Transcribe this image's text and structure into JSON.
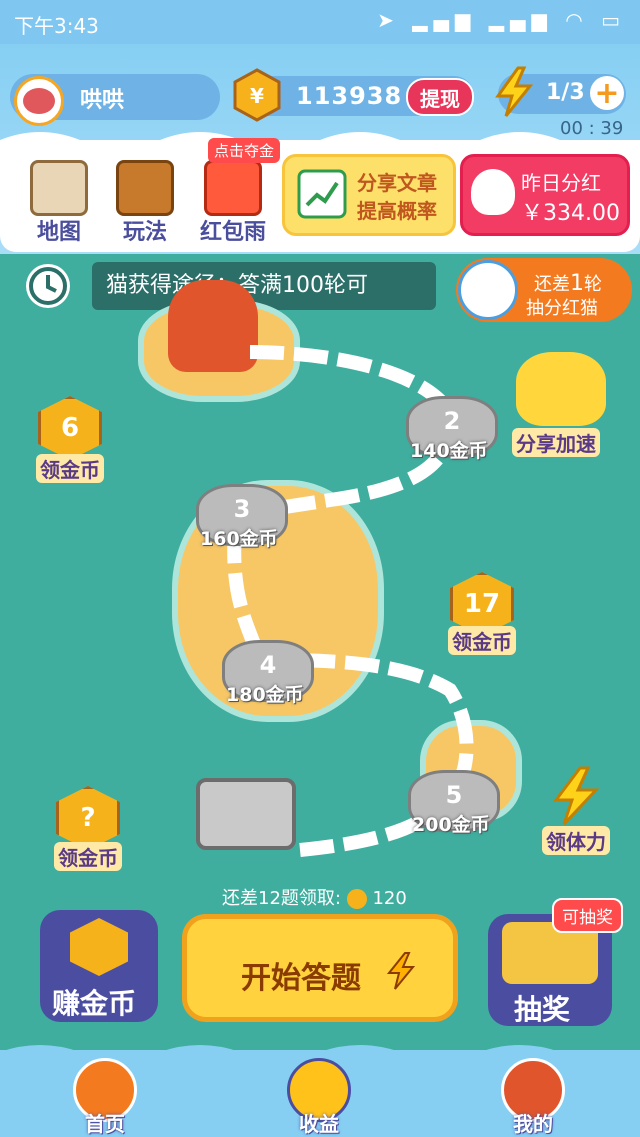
{
  "status_bar": {
    "time": "下午3:43"
  },
  "header": {
    "username": "哄哄",
    "coins": "113938",
    "withdraw_label": "提现",
    "energy": "1/3",
    "timer": "00 : 39"
  },
  "toolbar": {
    "items": [
      {
        "label": "地图",
        "icon": "map-icon"
      },
      {
        "label": "玩法",
        "icon": "rules-book-icon"
      },
      {
        "label": "红包雨",
        "icon": "red-envelope-rain-icon"
      }
    ],
    "grab_tag": "点击夺金",
    "share_line1": "分享文章",
    "share_line2": "提高概率",
    "bonus_line1": "昨日分红",
    "bonus_amount": "￥334.00"
  },
  "ticker": {
    "text": "猫获得途径：答满100轮可"
  },
  "lucky_cat": {
    "line1": "还差",
    "count": "1",
    "unit": "轮",
    "line2": "抽分红猫"
  },
  "map": {
    "stops": [
      {
        "num": "2",
        "label": "140金币"
      },
      {
        "num": "3",
        "label": "160金币"
      },
      {
        "num": "4",
        "label": "180金币"
      },
      {
        "num": "5",
        "label": "200金币"
      }
    ],
    "rewards": [
      {
        "value": "6",
        "label": "领金币"
      },
      {
        "value": "17",
        "label": "领金币"
      },
      {
        "value": "?",
        "label": "领金币"
      }
    ],
    "share_speed": "分享加速",
    "energy_reward": "领体力",
    "remain_text": "还差12题领取:",
    "remain_reward": "120"
  },
  "actions": {
    "earn_label": "赚金币",
    "start_label": "开始答题",
    "lottery_label": "抽奖",
    "lottery_tag": "可抽奖"
  },
  "tabs": [
    {
      "label": "首页"
    },
    {
      "label": "收益"
    },
    {
      "label": "我的"
    }
  ]
}
